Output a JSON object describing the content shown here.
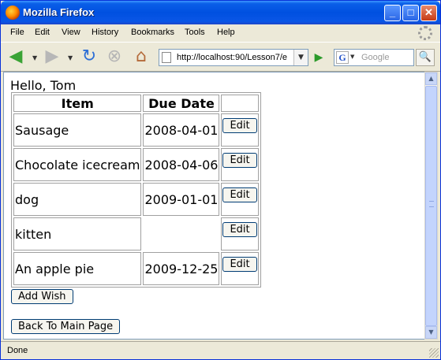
{
  "window": {
    "title": "Mozilla Firefox",
    "minimize_label": "_",
    "maximize_label": "□",
    "close_label": "✕"
  },
  "menu": {
    "file": "File",
    "edit": "Edit",
    "view": "View",
    "history": "History",
    "bookmarks": "Bookmarks",
    "tools": "Tools",
    "help": "Help"
  },
  "toolbar": {
    "url": "http://localhost:90/Lesson7/e",
    "search_placeholder": "Google",
    "search_engine_letter": "G"
  },
  "page": {
    "greeting": "Hello, Tom",
    "columns": {
      "item": "Item",
      "due_date": "Due Date"
    },
    "rows": [
      {
        "item": "Sausage",
        "due_date": "2008-04-01",
        "action": "Edit"
      },
      {
        "item": "Chocolate icecream",
        "due_date": "2008-04-06",
        "action": "Edit"
      },
      {
        "item": "dog",
        "due_date": "2009-01-01",
        "action": "Edit"
      },
      {
        "item": "kitten",
        "due_date": "",
        "action": "Edit"
      },
      {
        "item": "An apple pie",
        "due_date": "2009-12-25",
        "action": "Edit"
      }
    ],
    "add_button": "Add Wish",
    "back_button": "Back To Main Page"
  },
  "status": {
    "text": "Done"
  },
  "colors": {
    "titlebar": "#0050e0",
    "chrome": "#ece9d8"
  },
  "icons": [
    "firefox-logo-icon",
    "back-arrow-icon",
    "forward-arrow-icon",
    "reload-icon",
    "stop-icon",
    "home-icon",
    "page-icon",
    "go-arrow-icon",
    "magnifier-icon",
    "throbber-icon"
  ]
}
